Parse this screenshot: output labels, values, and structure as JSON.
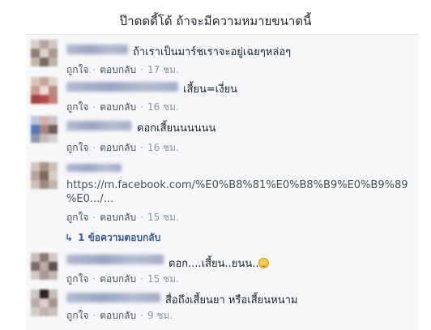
{
  "page": {
    "title": "ป๊าดดดี้โด้ ถ้าจะมีความหมายขนาดนี้"
  },
  "actions": {
    "like": "ถูกใจ",
    "reply": "ตอบกลับ",
    "separator": "·"
  },
  "comments": [
    {
      "text": "ถ้าเราเป็นมาร์ชเราจะอยู่เฉยๆหล่อๆ",
      "time": "17 ชม."
    },
    {
      "text": "เสี้ยน=เงี่ยน",
      "time": "16 ชม."
    },
    {
      "text": "ดอกเสี้ยนนนนนน",
      "time": "16 ชม."
    },
    {
      "text": "https://m.facebook.com/%E0%B8%81%E0%B8%B9%E0%B9%89 %E0.../...",
      "line1": "https://m.facebook.com/%E0%B8%81%E0%B8%B9%E0%B9%89",
      "line2": "%E0.../...",
      "time": "15 ชม."
    },
    {
      "text": "ดอก....เสี้ยน..ยนน..",
      "time": "15 ชม."
    },
    {
      "text": "สื่อถึงเสี้ยนยา หรือเสี้ยนหนาม",
      "time": "9 ชม."
    }
  ],
  "reply_link": {
    "icon": "reply-arrow-icon",
    "label": "1 ข้อความตอบกลับ"
  }
}
